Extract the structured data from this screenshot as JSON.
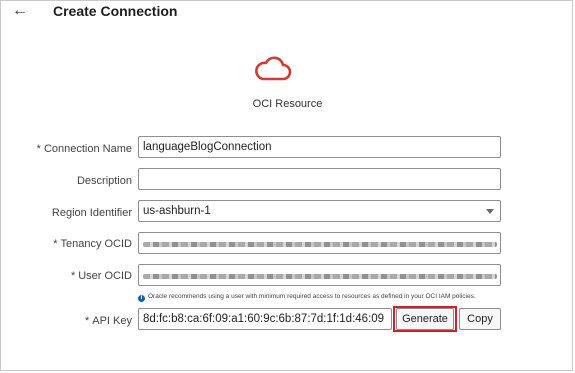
{
  "header": {
    "back_icon": "back-arrow-icon",
    "title": "Create Connection",
    "back_glyph": "←"
  },
  "resource": {
    "icon": "cloud-icon",
    "label": "OCI Resource",
    "icon_color": "#d33a36"
  },
  "form": {
    "connection_name": {
      "label": "Connection Name",
      "required": true,
      "value": "languageBlogConnection"
    },
    "description": {
      "label": "Description",
      "required": false,
      "value": ""
    },
    "region": {
      "label": "Region Identifier",
      "required": false,
      "value": "us-ashburn-1"
    },
    "tenancy_ocid": {
      "label": "Tenancy OCID",
      "required": true,
      "value": ""
    },
    "user_ocid": {
      "label": "User OCID",
      "required": true,
      "value": ""
    },
    "note": "Oracle recommends using a user with minimum required access to resources as defined in your OCI IAM policies.",
    "api_key": {
      "label": "API Key",
      "required": true,
      "value": "8d:fc:b8:ca:6f:09:a1:60:9c:6b:87:7d:1f:1d:46:09"
    },
    "generate_label": "Generate",
    "copy_label": "Copy",
    "required_marker": "*"
  },
  "colors": {
    "highlight": "#d21f2b",
    "info": "#1a5fa8"
  }
}
